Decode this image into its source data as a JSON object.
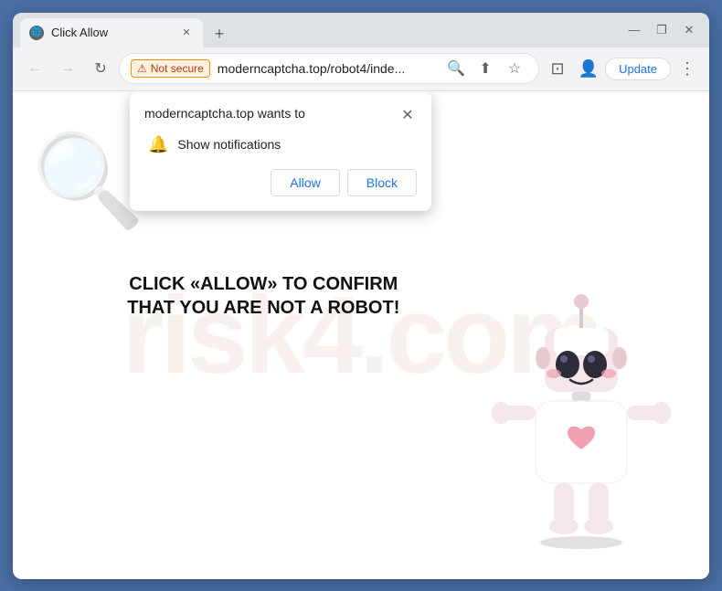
{
  "browser": {
    "tab": {
      "favicon": "🌐",
      "title": "Click Allow",
      "close": "✕"
    },
    "new_tab_btn": "+",
    "window_controls": {
      "minimize": "—",
      "maximize": "❐",
      "close": "✕"
    },
    "nav": {
      "back": "←",
      "forward": "→",
      "refresh": "↻"
    },
    "address_bar": {
      "security_label": "Not secure",
      "url": "moderncaptcha.top/robot4/inde...",
      "search_icon": "🔍",
      "share_icon": "⬆",
      "bookmark_icon": "☆",
      "tab_icon": "⊡",
      "profile_icon": "👤"
    },
    "update_btn": "Update",
    "menu_icon": "⋮"
  },
  "popup": {
    "title": "moderncaptcha.top wants to",
    "close": "✕",
    "permission": {
      "icon": "🔔",
      "text": "Show notifications"
    },
    "buttons": {
      "allow": "Allow",
      "block": "Block"
    }
  },
  "page": {
    "main_text": "CLICK «ALLOW» TO CONFIRM THAT YOU ARE NOT A ROBOT!",
    "watermark": "risk4.com"
  }
}
